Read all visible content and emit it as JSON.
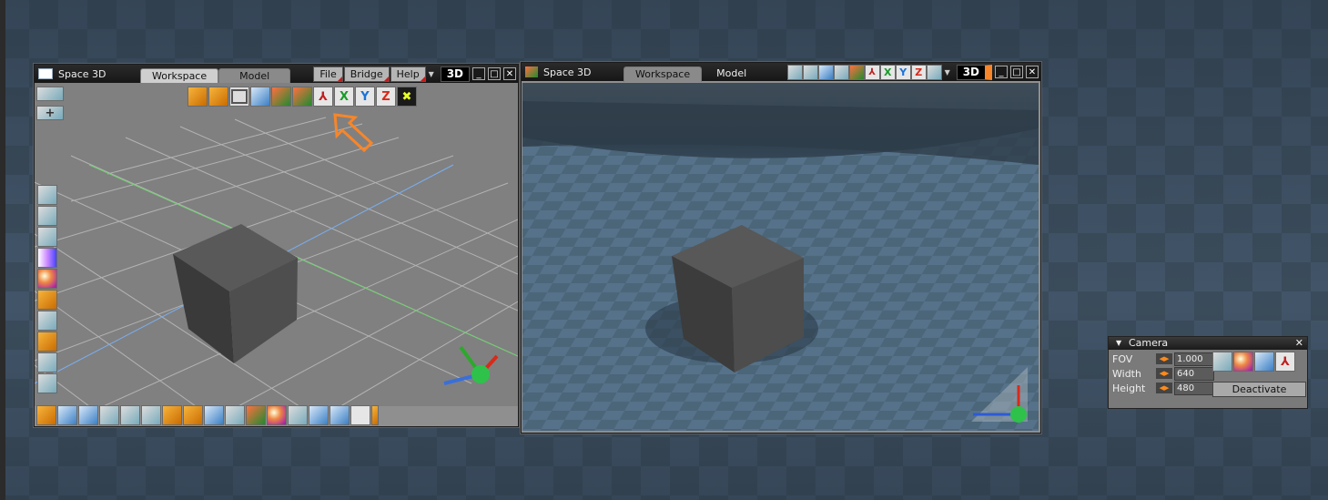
{
  "colors": {
    "accent_orange": "#f7862a",
    "axis_red": "#d82a1a",
    "axis_green": "#1a9a2a",
    "axis_blue": "#1b72d8"
  },
  "left_window": {
    "title": "Space 3D",
    "tabs": [
      "Workspace",
      "Model"
    ],
    "menus": [
      "File",
      "Bridge",
      "Help"
    ],
    "mode_badge": "3D",
    "toolbar_icons": [
      "cube-group-icon",
      "cube-icon",
      "frame-icon",
      "spotlight-icon",
      "house-icon",
      "house-alt-icon",
      "axes-icon",
      "x-axis-icon",
      "y-axis-icon",
      "z-axis-icon",
      "asterisk-icon"
    ],
    "toolbar_letters": {
      "x": "X",
      "y": "Y",
      "z": "Z"
    },
    "side_icons": [
      "mesh-icon",
      "spline-icon",
      "particles-icon",
      "cone-icon",
      "ball-icon",
      "cube-box-icon",
      "molecule-icon",
      "cubes-icon",
      "tools-icon",
      "pencil-icon"
    ],
    "bottom_icons": [
      "cube-icon",
      "cone-icon",
      "spot-icon",
      "mesh-icon",
      "terrain-icon",
      "wedge-icon",
      "lathe-icon",
      "lattice-icon",
      "paint-icon",
      "heart-icon",
      "flame-icon",
      "sphere-icon",
      "brush-icon",
      "plane-icon",
      "globe-icon",
      "axis-icon",
      "more-icon"
    ]
  },
  "right_window": {
    "title": "Space 3D",
    "tabs": [
      "Workspace",
      "Model"
    ],
    "mode_badge": "3D",
    "toolbar_icons": [
      "move-icon",
      "rotate-icon",
      "scale-icon",
      "grid-icon",
      "house-icon",
      "axes-icon",
      "x-axis-icon",
      "y-axis-icon",
      "z-axis-icon",
      "frame-icon"
    ],
    "toolbar_letters": {
      "x": "X",
      "y": "Y",
      "z": "Z"
    }
  },
  "camera_panel": {
    "title": "Camera",
    "fields": [
      {
        "label": "FOV",
        "value": "1.000"
      },
      {
        "label": "Width",
        "value": "640"
      },
      {
        "label": "Height",
        "value": "480"
      }
    ],
    "deactivate_label": "Deactivate",
    "icons": [
      "grid-icon",
      "sun-icon",
      "spotlight-icon",
      "axes-icon"
    ]
  }
}
